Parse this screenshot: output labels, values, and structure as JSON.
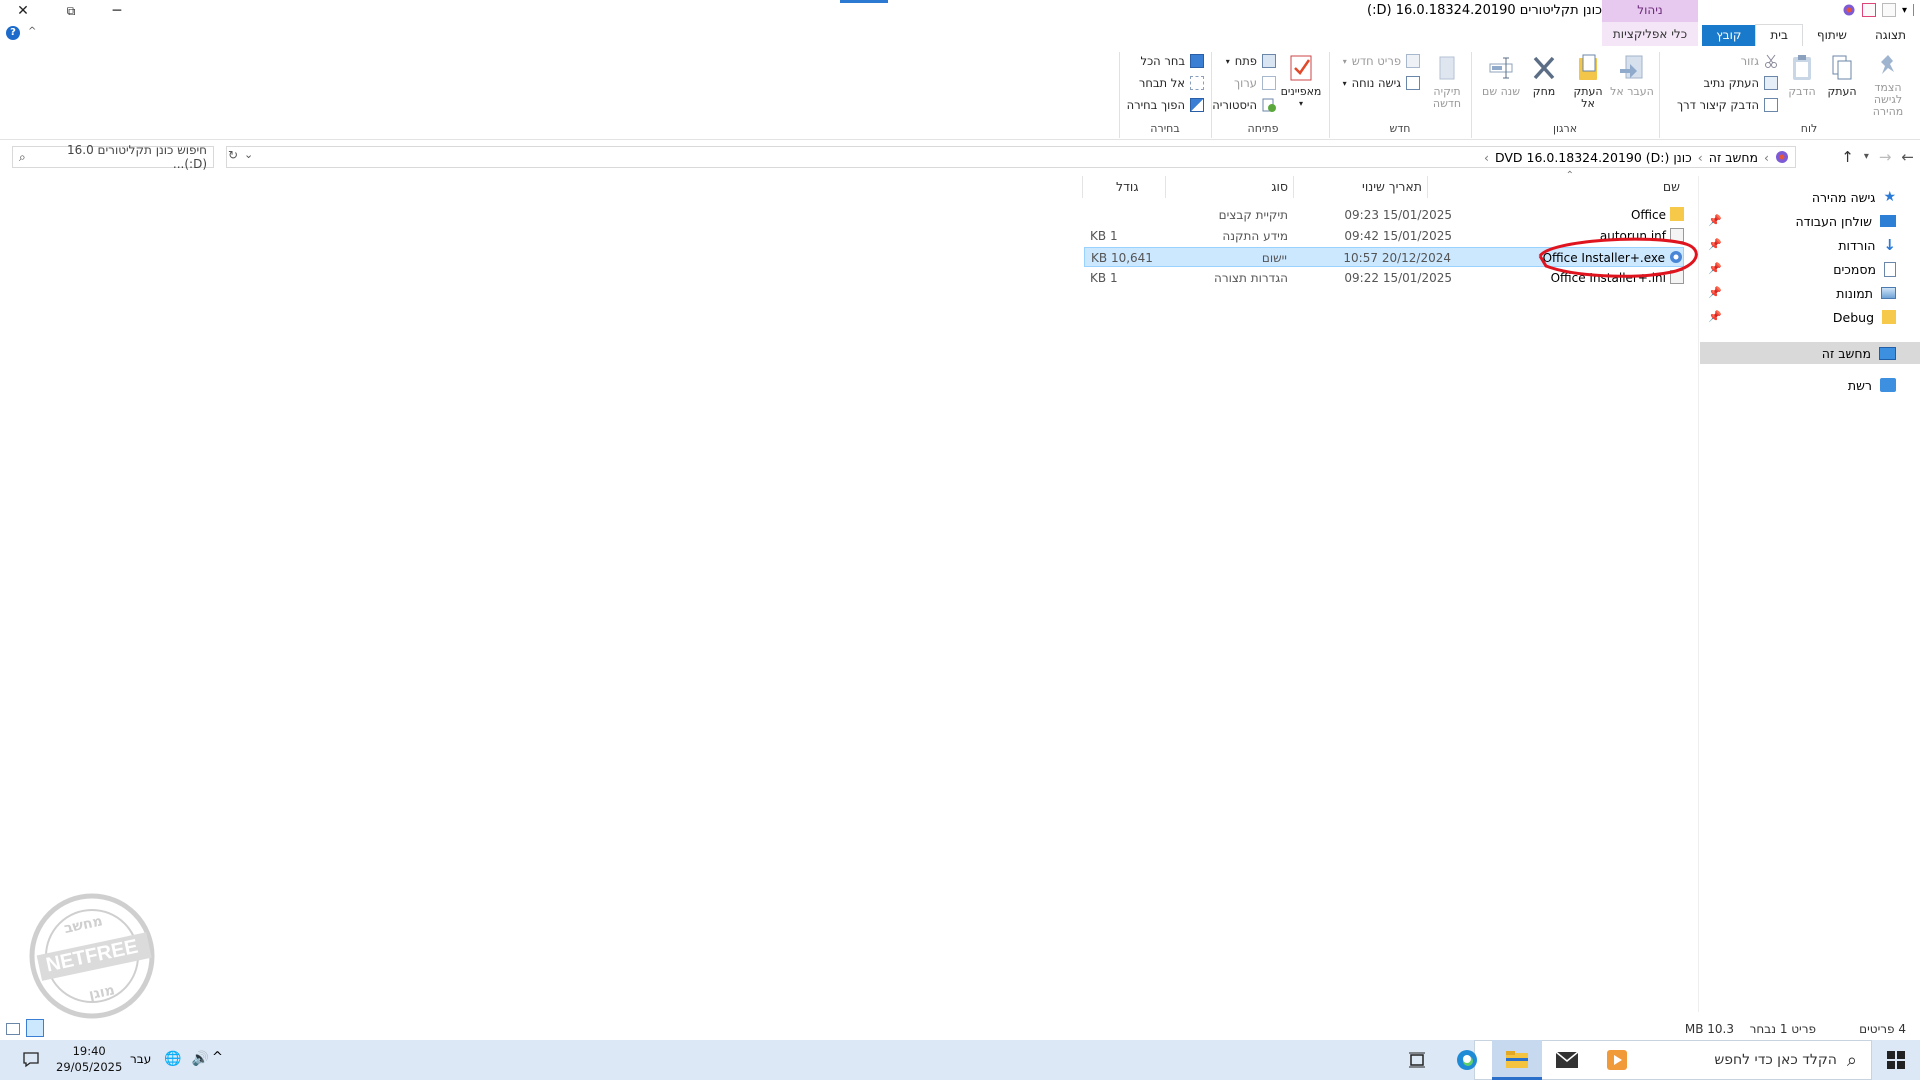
{
  "window": {
    "title": "כונן תקליטורים 16.0.18324.20190 (D:)",
    "context_group": "ניהול",
    "close_glyph": "✕",
    "restore_glyph": "⧉",
    "minimize_glyph": "─"
  },
  "tabs": {
    "file": "קובץ",
    "home": "בית",
    "share": "שיתוף",
    "view": "תצוגה",
    "apps": "כלי אפליקציות"
  },
  "ribbon": {
    "clipboard": {
      "label": "לוח",
      "pin": "הצמד לגישה מהירה",
      "copy": "העתק",
      "paste": "הדבק",
      "cut": "גזור",
      "copy_path": "העתק נתיב",
      "paste_shortcut": "הדבק קיצור דרך"
    },
    "organize": {
      "label": "ארגון",
      "move_to": "העבר אל",
      "copy_to": "העתק אל",
      "delete": "מחק",
      "rename": "שנה שם"
    },
    "new": {
      "label": "חדש",
      "new_folder": "תיקיה חדשה",
      "new_item": "פריט חדש",
      "easy_access": "גישה נוחה"
    },
    "open": {
      "label": "פתיחה",
      "properties": "מאפיינים",
      "open": "פתח",
      "edit": "ערוך",
      "history": "היסטוריה"
    },
    "select": {
      "label": "בחירה",
      "select_all": "בחר הכל",
      "select_none": "אל תבחר",
      "invert": "הפוך בחירה"
    }
  },
  "address": {
    "crumb_1": "מחשב זה",
    "crumb_2": "כונן DVD 16.0.18324.20190 (D:)",
    "separator": "›",
    "search_placeholder": "חיפוש כונן תקליטורים 16.0 (D:)..."
  },
  "nav": {
    "quick_access": "גישה מהירה",
    "desktop": "שולחן העבודה",
    "downloads": "הורדות",
    "documents": "מסמכים",
    "pictures": "תמונות",
    "debug": "Debug",
    "this_pc": "מחשב זה",
    "network": "רשת"
  },
  "columns": {
    "name": "שם",
    "date": "תאריך שינוי",
    "type": "סוג",
    "size": "גודל"
  },
  "files": [
    {
      "name": "Office",
      "date": "15/01/2025 09:23",
      "type": "תיקיית קבצים",
      "size": ""
    },
    {
      "name": "autorun.inf",
      "date": "15/01/2025 09:42",
      "type": "מידע התקנה",
      "size": "1 KB"
    },
    {
      "name": "Office Installer+.exe",
      "date": "20/12/2024 10:57",
      "type": "יישום",
      "size": "10,641 KB"
    },
    {
      "name": "Office Installer+.ini",
      "date": "15/01/2025 09:22",
      "type": "הגדרות תצורה",
      "size": "1 KB"
    }
  ],
  "status": {
    "count": "4 פריטים",
    "selected": "פריט 1 נבחר",
    "size": "10.3 MB"
  },
  "taskbar": {
    "search_placeholder": "הקלד כאן כדי לחפש",
    "time": "19:40",
    "date": "29/05/2025",
    "language": "עבר"
  },
  "watermark": {
    "top": "מחשב",
    "middle": "NETFREE",
    "bottom": "מוגן"
  },
  "colors": {
    "accent": "#1979ca",
    "selection": "#cce8ff",
    "annotation": "#e0141e",
    "taskbar": "#dde8f6"
  }
}
